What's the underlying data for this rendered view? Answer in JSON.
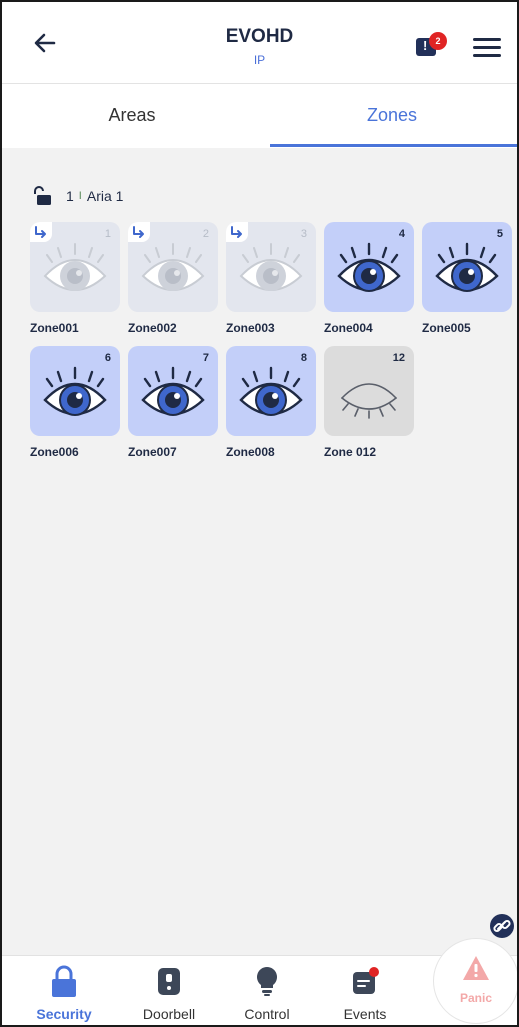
{
  "header": {
    "title": "EVOHD",
    "subtitle": "IP",
    "notification_count": "2"
  },
  "tabs": [
    {
      "label": "Areas",
      "active": false
    },
    {
      "label": "Zones",
      "active": true
    }
  ],
  "area": {
    "number": "1",
    "separator": "I",
    "name": "Aria 1"
  },
  "zones": [
    {
      "number": "1",
      "name": "Zone001",
      "state": "bypassed"
    },
    {
      "number": "2",
      "name": "Zone002",
      "state": "bypassed"
    },
    {
      "number": "3",
      "name": "Zone003",
      "state": "bypassed"
    },
    {
      "number": "4",
      "name": "Zone004",
      "state": "open"
    },
    {
      "number": "5",
      "name": "Zone005",
      "state": "open"
    },
    {
      "number": "6",
      "name": "Zone006",
      "state": "open"
    },
    {
      "number": "7",
      "name": "Zone007",
      "state": "open"
    },
    {
      "number": "8",
      "name": "Zone008",
      "state": "open"
    },
    {
      "number": "12",
      "name": "Zone 012",
      "state": "closed"
    }
  ],
  "bottom_nav": {
    "items": [
      {
        "label": "Security",
        "icon": "padlock-icon",
        "active": true
      },
      {
        "label": "Doorbell",
        "icon": "doorbell-icon",
        "active": false
      },
      {
        "label": "Control",
        "icon": "lightbulb-icon",
        "active": false
      },
      {
        "label": "Events",
        "icon": "events-icon",
        "active": false
      }
    ],
    "panic_label": "Panic"
  },
  "colors": {
    "accent": "#4a74d9",
    "dark": "#1f2a44",
    "active_tile": "#c3cff9",
    "bypassed_tile": "#e3e6ee",
    "closed_tile": "#dcdcdc",
    "badge": "#e02424",
    "panic": "#f3a8a8"
  }
}
